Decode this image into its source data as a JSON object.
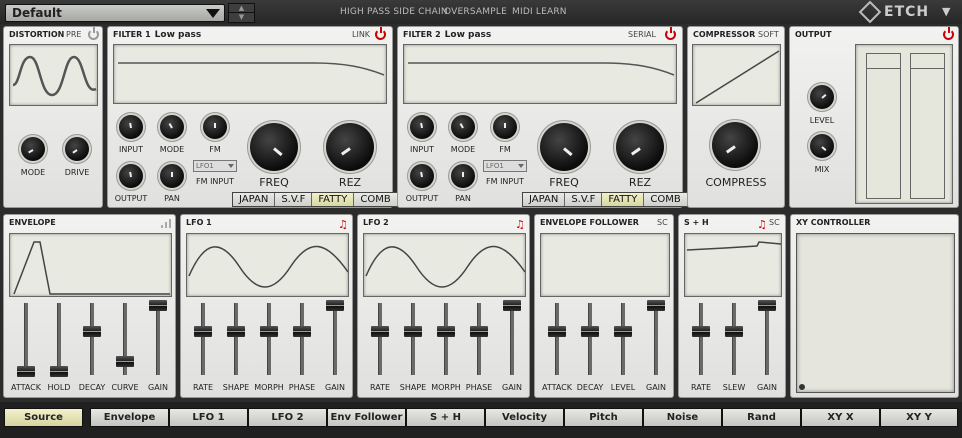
{
  "topbar": {
    "preset": "Default",
    "links": [
      "HIGH PASS SIDE CHAIN",
      "OVERSAMPLE",
      "MIDI LEARN"
    ],
    "logo": "ETCH"
  },
  "distortion": {
    "title": "DISTORTION",
    "tag": "PRE",
    "knobs": [
      "MODE",
      "DRIVE"
    ]
  },
  "filter1": {
    "title": "FILTER 1",
    "type": "Low pass",
    "tag": "LINK",
    "knobs": [
      "INPUT",
      "MODE",
      "FM",
      "OUTPUT",
      "PAN"
    ],
    "fm_select": "LFO1",
    "fm_input": "FM INPUT",
    "big": [
      "FREQ",
      "REZ"
    ],
    "tabs": [
      "JAPAN",
      "S.V.F",
      "FATTY",
      "COMB"
    ],
    "active_tab": "FATTY"
  },
  "filter2": {
    "title": "FILTER 2",
    "type": "Low pass",
    "tag": "SERIAL",
    "knobs": [
      "INPUT",
      "MODE",
      "FM",
      "OUTPUT",
      "PAN"
    ],
    "fm_select": "LFO1",
    "fm_input": "FM INPUT",
    "big": [
      "FREQ",
      "REZ"
    ],
    "tabs": [
      "JAPAN",
      "S.V.F",
      "FATTY",
      "COMB"
    ],
    "active_tab": "FATTY"
  },
  "compressor": {
    "title": "COMPRESSOR",
    "tag": "SOFT",
    "knob": "COMPRESS"
  },
  "output": {
    "title": "OUTPUT",
    "knobs": [
      "LEVEL",
      "MIX"
    ]
  },
  "envelope": {
    "title": "ENVELOPE",
    "faders": [
      "ATTACK",
      "HOLD",
      "DECAY",
      "CURVE",
      "GAIN"
    ],
    "values": [
      0.0,
      0.0,
      0.6,
      0.15,
      1.0
    ]
  },
  "lfo1": {
    "title": "LFO 1",
    "faders": [
      "RATE",
      "SHAPE",
      "MORPH",
      "PHASE",
      "GAIN"
    ],
    "values": [
      0.6,
      0.6,
      0.6,
      0.6,
      1.0
    ]
  },
  "lfo2": {
    "title": "LFO 2",
    "faders": [
      "RATE",
      "SHAPE",
      "MORPH",
      "PHASE",
      "GAIN"
    ],
    "values": [
      0.6,
      0.6,
      0.6,
      0.6,
      1.0
    ]
  },
  "envfollower": {
    "title": "ENVELOPE FOLLOWER",
    "tag": "SC",
    "faders": [
      "ATTACK",
      "DECAY",
      "LEVEL",
      "GAIN"
    ],
    "values": [
      0.6,
      0.6,
      0.6,
      1.0
    ]
  },
  "sh": {
    "title": "S + H",
    "tag": "SC",
    "faders": [
      "RATE",
      "SLEW",
      "GAIN"
    ],
    "values": [
      0.6,
      0.6,
      1.0
    ]
  },
  "xy": {
    "title": "XY CONTROLLER"
  },
  "sources": {
    "items": [
      "Source",
      "Envelope",
      "LFO 1",
      "LFO 2",
      "Env Follower",
      "S + H",
      "Velocity",
      "Pitch",
      "Noise",
      "Rand",
      "XY X",
      "XY Y"
    ],
    "active": "Source"
  },
  "colors": {
    "accent": "#cc0000",
    "display": "#e8e9e0",
    "active_tab": "#e6e4b4"
  }
}
